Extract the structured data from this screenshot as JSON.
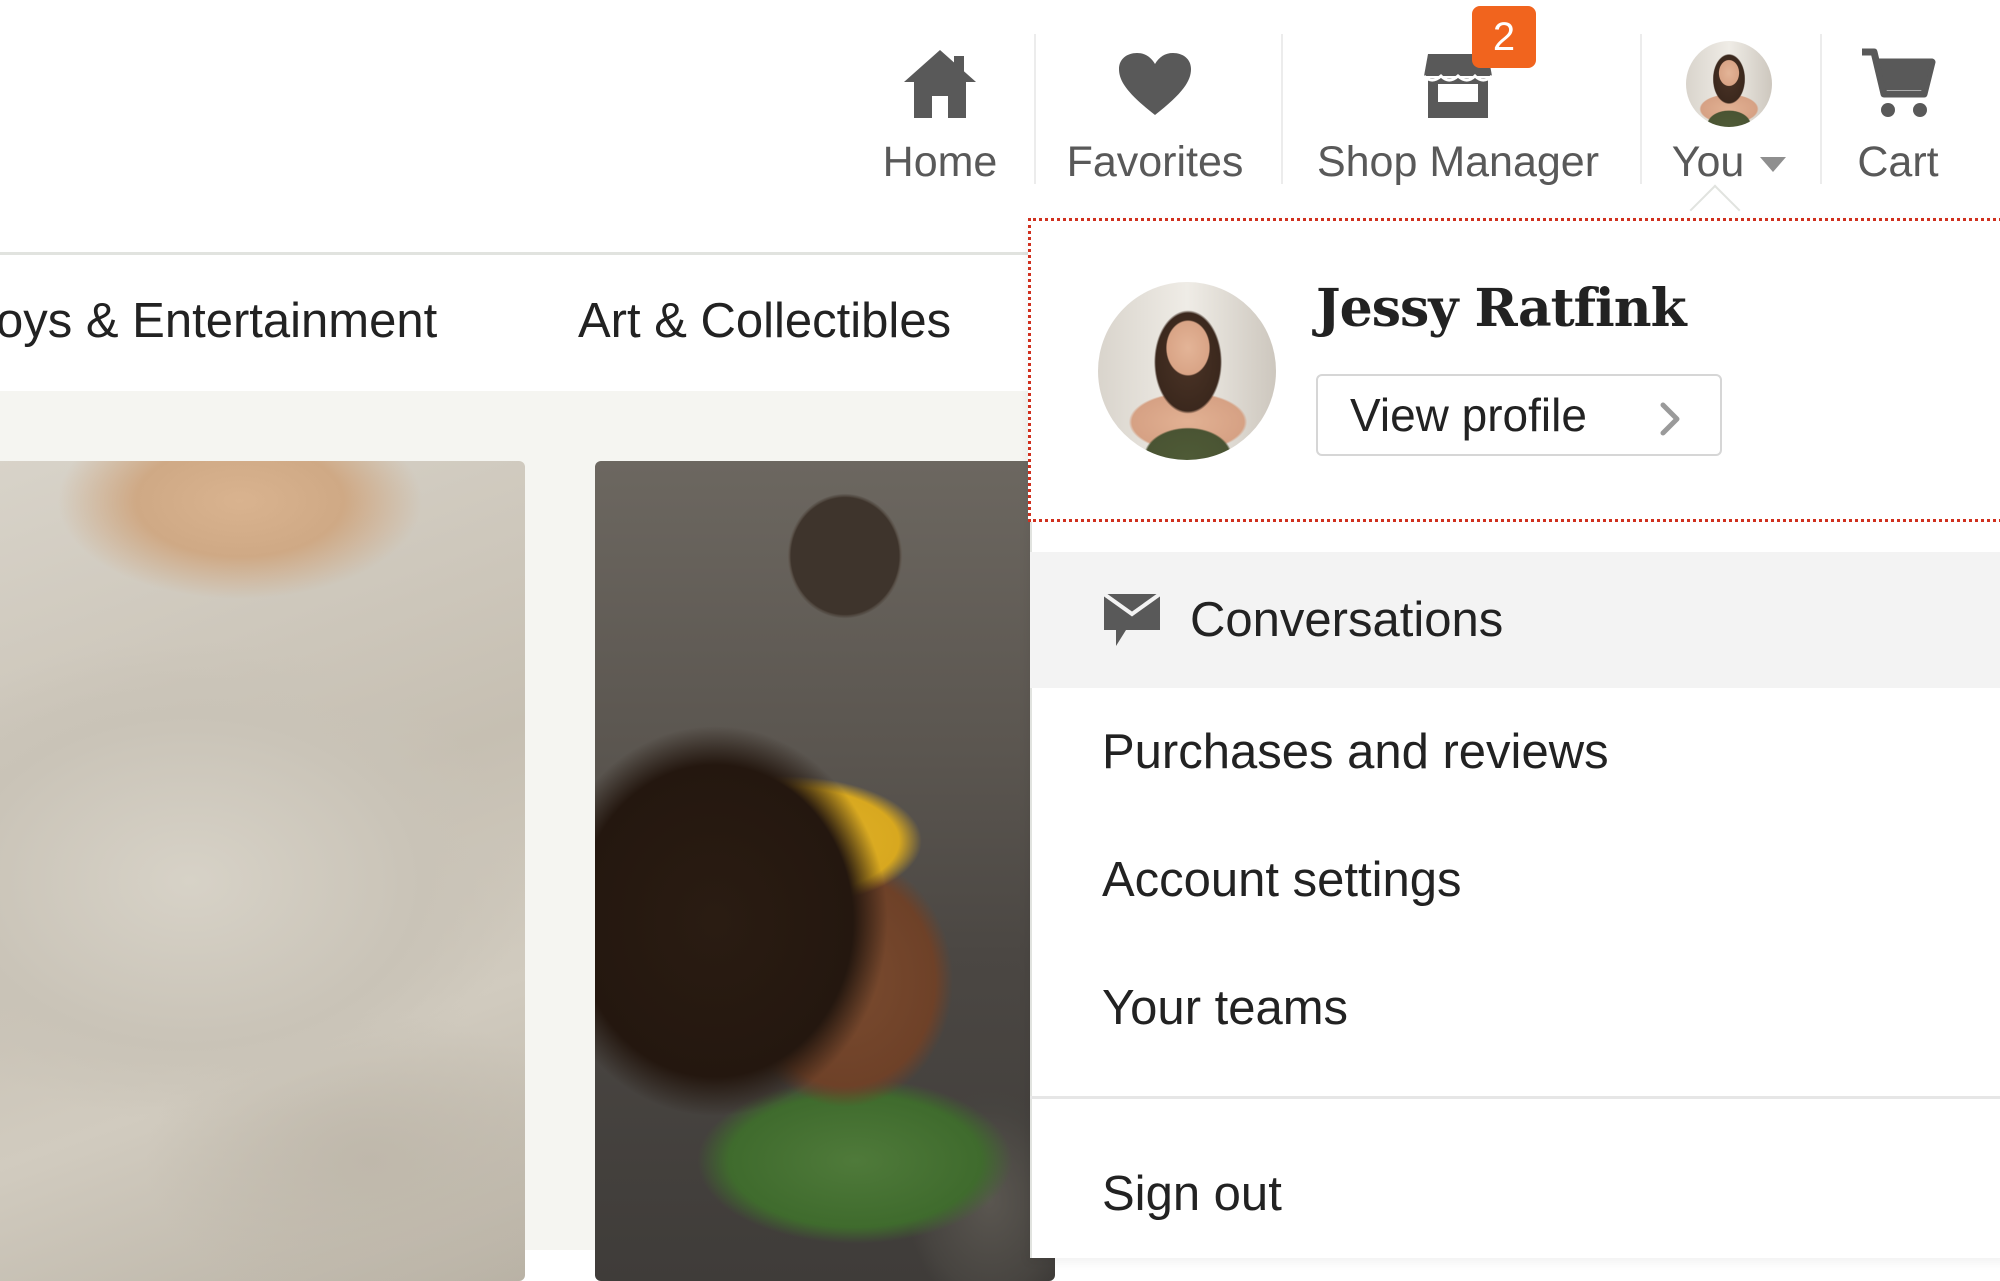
{
  "nav": {
    "home": "Home",
    "favorites": "Favorites",
    "shop_manager": "Shop Manager",
    "shop_badge": "2",
    "you": "You",
    "cart": "Cart"
  },
  "categories": {
    "item1": "oys & Entertainment",
    "item2": "Art & Collectibles"
  },
  "profile": {
    "name": "Jessy Ratfink",
    "view_profile": "View profile"
  },
  "menu": {
    "conversations": "Conversations",
    "purchases": "Purchases and reviews",
    "account": "Account settings",
    "teams": "Your teams",
    "signout": "Sign out"
  },
  "colors": {
    "badge": "#f1641e",
    "focus_outline": "#d0301e",
    "nav_text": "#595959"
  }
}
